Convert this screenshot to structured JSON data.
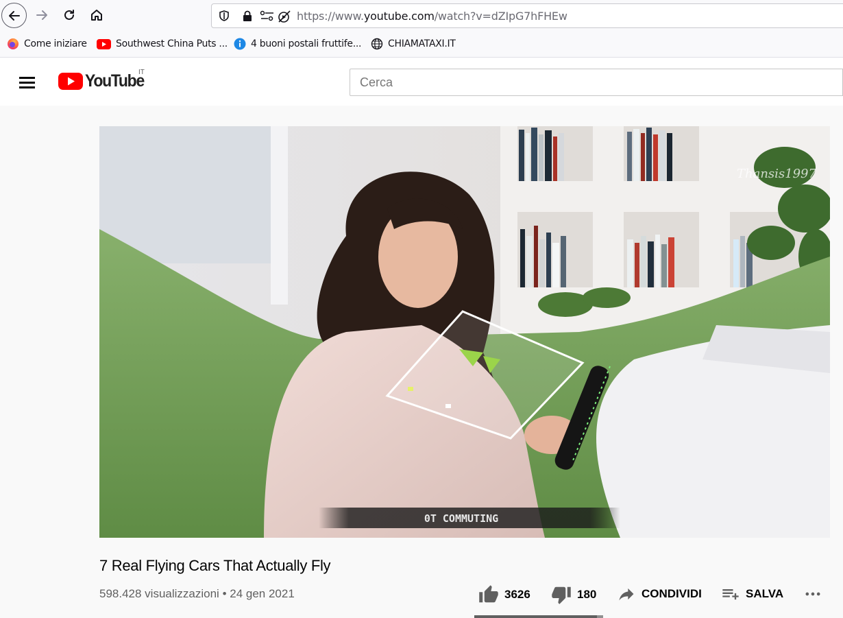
{
  "browser": {
    "url_prefix": "https://www.",
    "url_domain": "youtube.com",
    "url_path": "/watch?v=dZIpG7hFHEw"
  },
  "bookmarks": [
    {
      "label": "Come iniziare",
      "icon": "firefox-icon"
    },
    {
      "label": "Southwest China Puts ...",
      "icon": "youtube-icon"
    },
    {
      "label": "4 buoni postali fruttife...",
      "icon": "info-icon"
    },
    {
      "label": "CHIAMATAXI.IT",
      "icon": "globe-icon"
    }
  ],
  "header": {
    "logo_text": "YouTube",
    "country": "IT",
    "search_placeholder": "Cerca"
  },
  "video": {
    "overlay_caption": "0T COMMUTING",
    "watermark": "Thansis1997",
    "title": "7 Real Flying Cars That Actually Fly",
    "views": "598.428 visualizzazioni",
    "separator": " • ",
    "date": "24 gen 2021",
    "likes": "3626",
    "dislikes": "180",
    "share_label": "CONDIVIDI",
    "save_label": "SALVA",
    "like_ratio": 0.95
  },
  "colors": {
    "youtube_red": "#ff0000",
    "sofa_green": "#7aa75c"
  }
}
